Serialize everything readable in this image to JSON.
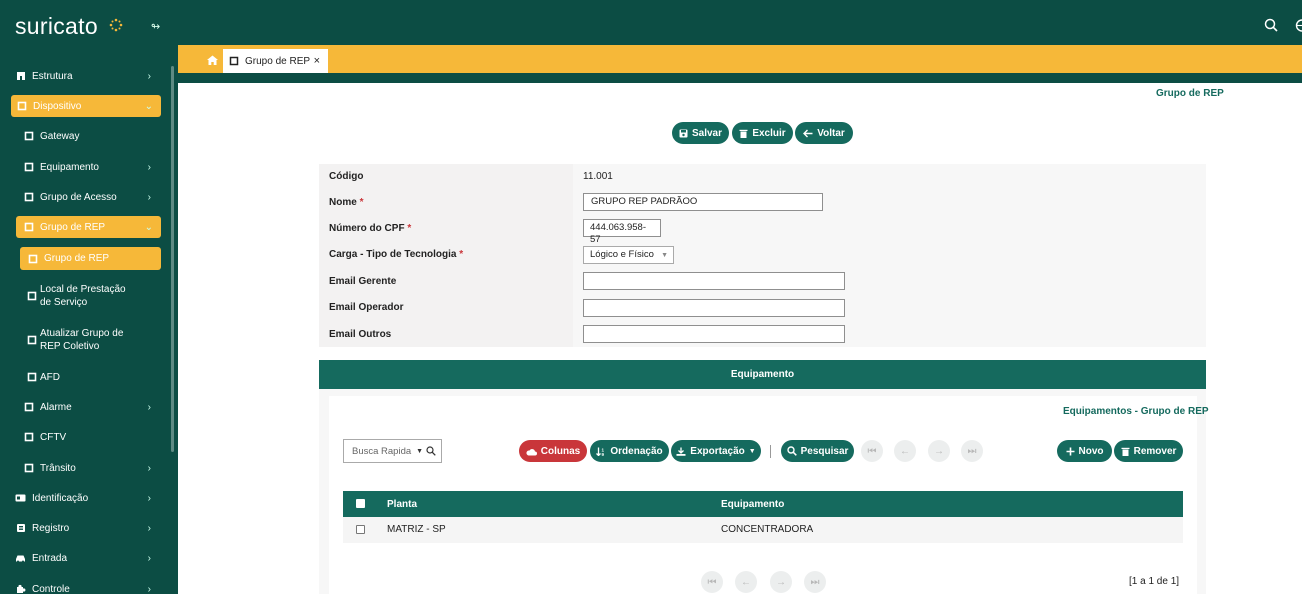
{
  "app": {
    "brand": "suricato"
  },
  "sidebar": {
    "items": [
      {
        "label": "Estrutura"
      },
      {
        "label": "Dispositivo"
      },
      {
        "label": "Gateway"
      },
      {
        "label": "Equipamento"
      },
      {
        "label": "Grupo de Acesso"
      },
      {
        "label": "Grupo de REP"
      },
      {
        "label": "Grupo de REP"
      },
      {
        "label": "Local de Prestação de Serviço"
      },
      {
        "label": "Atualizar Grupo de REP Coletivo"
      },
      {
        "label": "AFD"
      },
      {
        "label": "Alarme"
      },
      {
        "label": "CFTV"
      },
      {
        "label": "Trânsito"
      },
      {
        "label": "Identificação"
      },
      {
        "label": "Registro"
      },
      {
        "label": "Entrada"
      },
      {
        "label": "Controle"
      }
    ]
  },
  "tab": {
    "label": "Grupo de REP",
    "close": "×"
  },
  "page": {
    "breadcrumb": "Grupo de REP"
  },
  "toolbar": {
    "save": "Salvar",
    "delete": "Excluir",
    "back": "Voltar"
  },
  "form": {
    "codigo_label": "Código",
    "codigo_value": "11.001",
    "nome_label": "Nome",
    "nome_value": "GRUPO REP PADRÃOO",
    "cpf_label": "Número do CPF",
    "cpf_value": "444.063.958-57",
    "carga_label": "Carga - Tipo de Tecnologia",
    "carga_value": "Lógico e Físico",
    "email_gerente_label": "Email Gerente",
    "email_gerente_value": "",
    "email_operador_label": "Email Operador",
    "email_operador_value": "",
    "email_outros_label": "Email Outros",
    "email_outros_value": "",
    "required_mark": "*"
  },
  "equipment": {
    "section_title": "Equipamento",
    "grid_title": "Equipamentos - Grupo de REP",
    "search_placeholder": "Busca Rapida",
    "buttons": {
      "colunas": "Colunas",
      "ordenacao": "Ordenação",
      "exportacao": "Exportação",
      "pesquisar": "Pesquisar",
      "novo": "Novo",
      "remover": "Remover"
    },
    "columns": [
      "Planta",
      "Equipamento"
    ],
    "rows": [
      {
        "planta": "MATRIZ - SP",
        "equipamento": "CONCENTRADORA"
      }
    ],
    "pagination": "[1 a 1 de 1]"
  },
  "colors": {
    "sidebar": "#0c4d44",
    "accent": "#f6b839",
    "teal": "#156a5e",
    "red": "#c9363a"
  }
}
